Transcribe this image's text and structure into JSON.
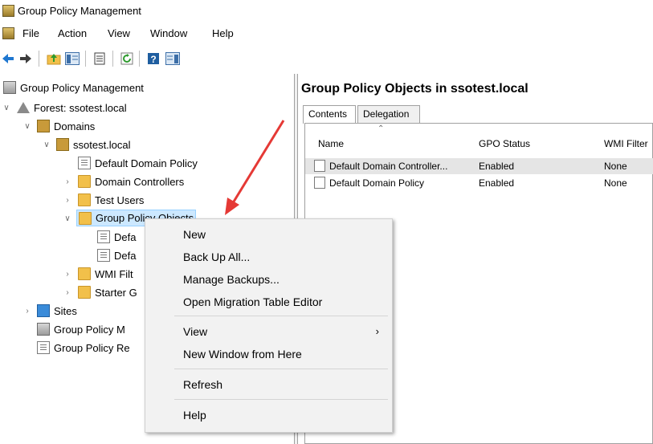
{
  "window": {
    "title": "Group Policy Management"
  },
  "menubar": {
    "items": [
      "File",
      "Action",
      "View",
      "Window",
      "Help"
    ]
  },
  "toolbar": {
    "icons": [
      "back-arrow-icon",
      "forward-arrow-icon",
      "up-folder-icon",
      "show-hide-tree-icon",
      "properties-icon",
      "refresh-icon",
      "help-icon",
      "show-hide-action-pane-icon"
    ]
  },
  "tree": {
    "root": "Group Policy Management",
    "forest": "Forest: ssotest.local",
    "domains": "Domains",
    "domain": "ssotest.local",
    "default_domain_policy": "Default Domain Policy",
    "domain_controllers": "Domain Controllers",
    "test_users": "Test Users",
    "gpo": "Group Policy Objects",
    "gpo_child1": "Defa",
    "gpo_child2": "Defa",
    "wmi": "WMI Filt",
    "starter": "Starter G",
    "sites": "Sites",
    "modeling": "Group Policy M",
    "results": "Group Policy Re"
  },
  "right": {
    "title": "Group Policy Objects in ssotest.local",
    "tabs": [
      "Contents",
      "Delegation"
    ],
    "columns": [
      "Name",
      "GPO Status",
      "WMI Filter"
    ],
    "rows": [
      {
        "name": "Default Domain Controller...",
        "status": "Enabled",
        "wmi": "None"
      },
      {
        "name": "Default Domain Policy",
        "status": "Enabled",
        "wmi": "None"
      }
    ]
  },
  "context_menu": {
    "items": [
      "New",
      "Back Up All...",
      "Manage Backups...",
      "Open Migration Table Editor",
      "View",
      "New Window from Here",
      "Refresh",
      "Help"
    ]
  },
  "colors": {
    "arrow": "#e53935",
    "selection": "#cce8ff"
  }
}
